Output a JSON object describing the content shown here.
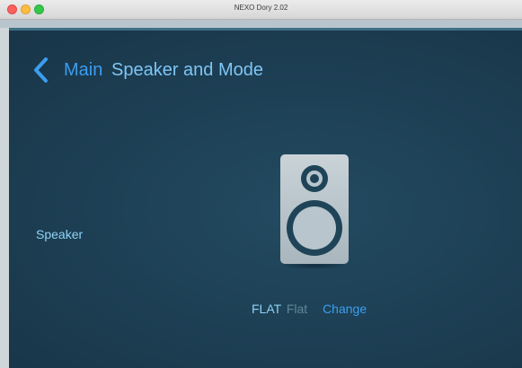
{
  "window": {
    "title": "NEXO Dory 2.02"
  },
  "header": {
    "back_label": "Main",
    "title": "Speaker and Mode"
  },
  "speaker": {
    "label": "Speaker",
    "icon": "speaker-icon"
  },
  "mode": {
    "code": "FLAT",
    "name": "Flat",
    "change_label": "Change"
  },
  "colors": {
    "background": "#1f3f52",
    "accent": "#3c9df0",
    "title": "#7fc6f4",
    "label": "#8ed3f7",
    "muted": "#5f8797"
  }
}
